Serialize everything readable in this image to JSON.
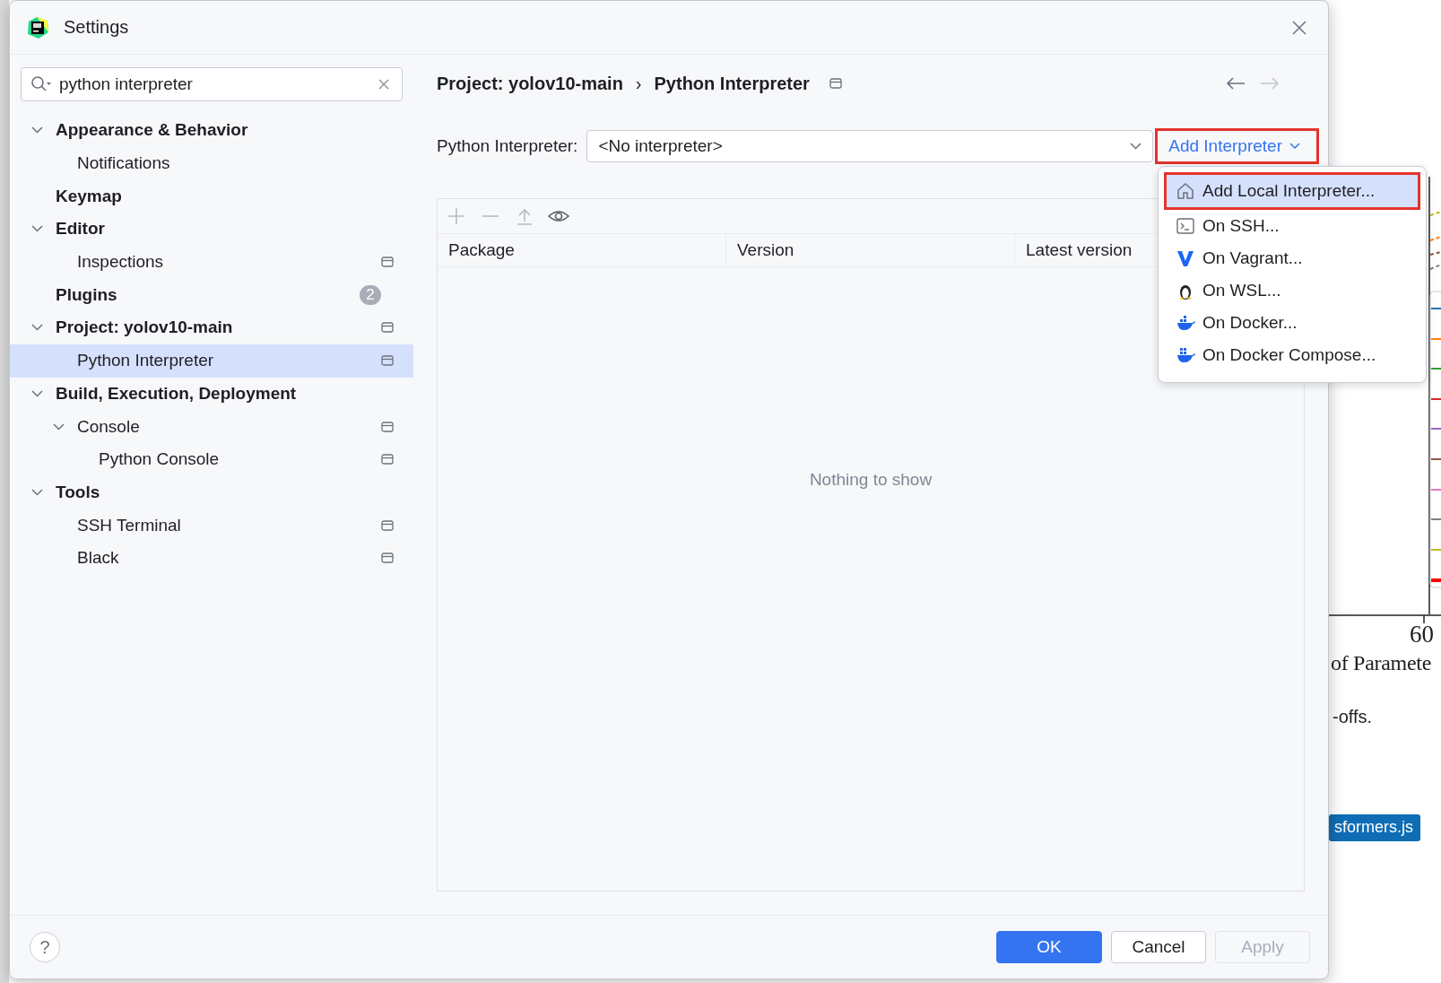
{
  "window": {
    "title": "Settings"
  },
  "search": {
    "value": "python interpreter"
  },
  "tree": [
    {
      "label": "Appearance & Behavior",
      "expanded": true,
      "selected": false,
      "children": [
        {
          "label": "Notifications",
          "selected": false
        }
      ]
    },
    {
      "label": "Keymap",
      "selected": false
    },
    {
      "label": "Editor",
      "expanded": true,
      "selected": false,
      "children": [
        {
          "label": "Inspections",
          "selected": false,
          "project_level": true
        }
      ]
    },
    {
      "label": "Plugins",
      "selected": false,
      "badge": "2"
    },
    {
      "label": "Project: yolov10-main",
      "expanded": true,
      "selected": false,
      "project_level": true,
      "children": [
        {
          "label": "Python Interpreter",
          "selected": true,
          "project_level": true
        }
      ]
    },
    {
      "label": "Build, Execution, Deployment",
      "expanded": true,
      "selected": false,
      "children": [
        {
          "label": "Console",
          "expanded": true,
          "selected": false,
          "project_level": true,
          "children": [
            {
              "label": "Python Console",
              "selected": false,
              "project_level": true
            }
          ]
        }
      ]
    },
    {
      "label": "Tools",
      "expanded": true,
      "selected": false,
      "children": [
        {
          "label": "SSH Terminal",
          "selected": false,
          "project_level": true
        },
        {
          "label": "Black",
          "selected": false,
          "project_level": true
        }
      ]
    }
  ],
  "breadcrumb": {
    "items": [
      "Project: yolov10-main",
      "Python Interpreter"
    ],
    "separator": "›",
    "project_level": true
  },
  "nav": {
    "back_enabled": true,
    "forward_enabled": false
  },
  "interpreter": {
    "label": "Python Interpreter:",
    "value": "<No interpreter>",
    "add_button": "Add Interpreter",
    "annotated": true
  },
  "toolbar": [
    {
      "kind": "add",
      "disabled": true
    },
    {
      "kind": "remove",
      "disabled": true
    },
    {
      "kind": "upgrade",
      "disabled": true
    },
    {
      "kind": "eye",
      "disabled": false
    }
  ],
  "table": {
    "columns": [
      "Package",
      "Version",
      "Latest version"
    ],
    "empty_text": "Nothing to show"
  },
  "menu": [
    {
      "kind": "local",
      "label": "Add Local Interpreter...",
      "selected": true,
      "annotated": true
    },
    {
      "kind": "ssh",
      "label": "On SSH...",
      "selected": false,
      "annotated": false
    },
    {
      "kind": "vagrant",
      "label": "On Vagrant...",
      "selected": false,
      "annotated": false
    },
    {
      "kind": "wsl",
      "label": "On WSL...",
      "selected": false,
      "annotated": false
    },
    {
      "kind": "docker",
      "label": "On Docker...",
      "selected": false,
      "annotated": false
    },
    {
      "kind": "compose",
      "label": "On Docker Compose...",
      "selected": false,
      "annotated": false
    }
  ],
  "footer": {
    "help": "?",
    "buttons": [
      {
        "label": "OK",
        "kind": "primary",
        "disabled": false
      },
      {
        "label": "Cancel",
        "kind": "normal",
        "disabled": false
      },
      {
        "label": "Apply",
        "kind": "normal",
        "disabled": true
      }
    ]
  },
  "background": {
    "legend": [
      {
        "color": "#1f77b4"
      },
      {
        "color": "#ff7f0e"
      },
      {
        "color": "#2ca02c"
      },
      {
        "color": "#d62728"
      },
      {
        "color": "#9467bd"
      },
      {
        "color": "#8c564b"
      },
      {
        "color": "#e377c2"
      },
      {
        "color": "#7f7f7f"
      },
      {
        "color": "#bcbd22"
      },
      {
        "color": "#ff0000"
      }
    ],
    "axis_tick": "60",
    "axis_label": "of Paramete",
    "text": "-offs.",
    "badge": "sformers.js"
  }
}
